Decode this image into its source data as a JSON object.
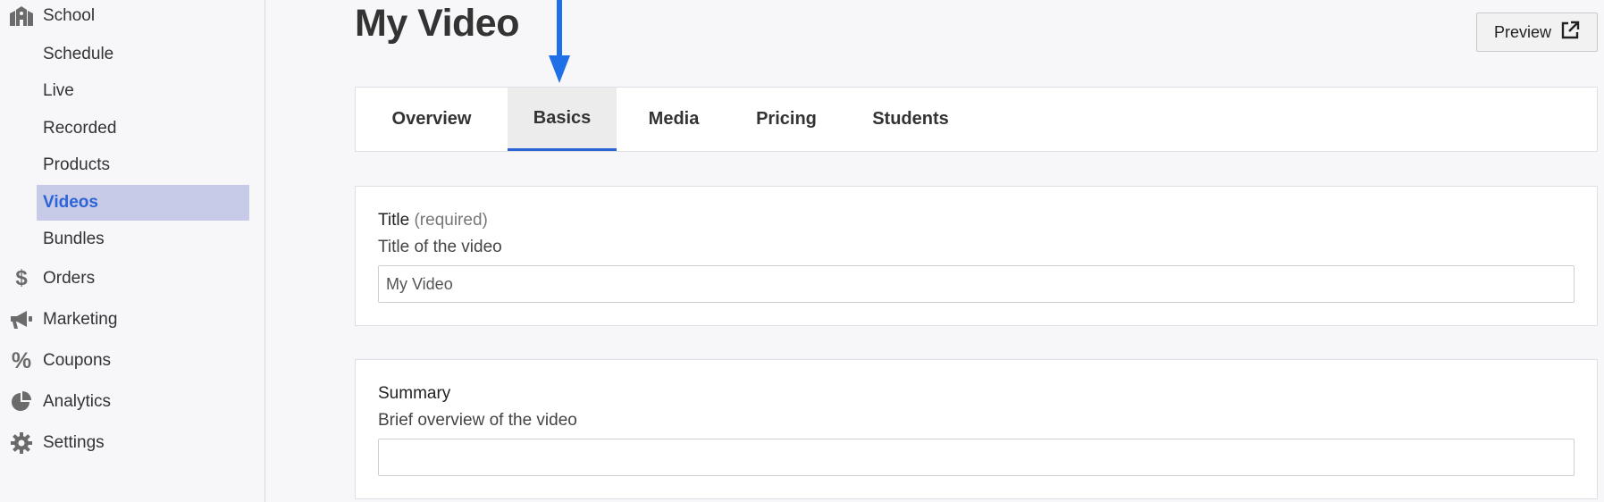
{
  "sidebar": {
    "school": "School",
    "sub_items": [
      "Schedule",
      "Live",
      "Recorded",
      "Products",
      "Videos",
      "Bundles"
    ],
    "active_sub_item": "Videos",
    "items": [
      {
        "label": "Orders",
        "icon": "dollar-icon"
      },
      {
        "label": "Marketing",
        "icon": "megaphone-icon"
      },
      {
        "label": "Coupons",
        "icon": "percent-icon"
      },
      {
        "label": "Analytics",
        "icon": "pie-chart-icon"
      },
      {
        "label": "Settings",
        "icon": "gear-icon"
      }
    ]
  },
  "header": {
    "title": "My Video",
    "preview_label": "Preview"
  },
  "tabs": [
    {
      "label": "Overview"
    },
    {
      "label": "Basics"
    },
    {
      "label": "Media"
    },
    {
      "label": "Pricing"
    },
    {
      "label": "Students"
    }
  ],
  "active_tab": "Basics",
  "form": {
    "title_label": "Title",
    "title_required": "(required)",
    "title_help": "Title of the video",
    "title_value": "My Video",
    "summary_label": "Summary",
    "summary_help": "Brief overview of the video",
    "summary_value": ""
  },
  "colors": {
    "accent": "#2c63d6",
    "arrow": "#1f6fe6",
    "active_nav_bg": "#c8cbe8"
  }
}
